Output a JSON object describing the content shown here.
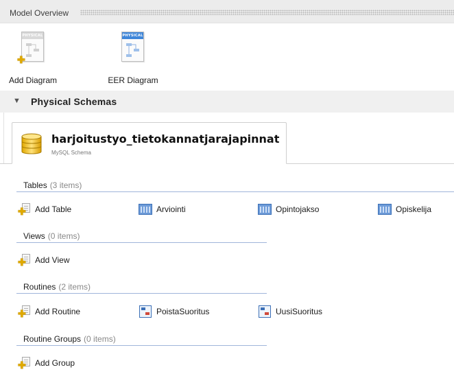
{
  "header": {
    "title": "Model Overview"
  },
  "diagrams": {
    "add": {
      "label": "Add Diagram",
      "badge": "PHYSICAL"
    },
    "eer": {
      "label": "EER Diagram",
      "badge": "PHYSICAL"
    }
  },
  "section": {
    "title": "Physical Schemas"
  },
  "schema": {
    "name": "harjoitustyo_tietokannatjarajapinnat",
    "subtitle": "MySQL Schema"
  },
  "groups": {
    "tables": {
      "name": "Tables",
      "count": "(3 items)",
      "add_label": "Add Table",
      "items": [
        "Arviointi",
        "Opintojakso",
        "Opiskelija"
      ]
    },
    "views": {
      "name": "Views",
      "count": "(0 items)",
      "add_label": "Add View"
    },
    "routines": {
      "name": "Routines",
      "count": "(2 items)",
      "add_label": "Add Routine",
      "items": [
        "PoistaSuoritus",
        "UusiSuoritus"
      ]
    },
    "routine_groups": {
      "name": "Routine Groups",
      "count": "(0 items)",
      "add_label": "Add Group"
    }
  },
  "colors": {
    "accent": "#3f86d9",
    "add_badge": "#e0a900",
    "group_line": "#9fb5da"
  }
}
